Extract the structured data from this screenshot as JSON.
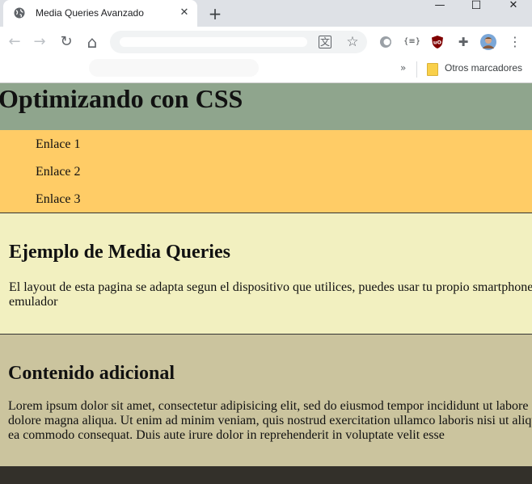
{
  "browser": {
    "tab_title": "Media Queries Avanzado",
    "tab_close_glyph": "✕",
    "new_tab_glyph": "+",
    "window_minimize_glyph": "—",
    "window_maximize_glyph": "☐",
    "window_close_glyph": "✕",
    "back_glyph": "←",
    "forward_glyph": "→",
    "reload_glyph": "↻",
    "home_glyph": "⌂",
    "translate_glyph": "文",
    "star_glyph": "☆",
    "menu_glyph": "⋮",
    "bookmarks_chevron": "»",
    "bookmarks_folder_label": "Otros marcadores",
    "extensions": {
      "ext_json_label": "{≡}",
      "ublock_label": "uO",
      "puzzle_glyph": "✚"
    }
  },
  "page": {
    "title": "Optimizando con CSS",
    "nav_links": [
      "Enlace 1",
      "Enlace 2",
      "Enlace 3"
    ],
    "section1": {
      "heading": "Ejemplo de Media Queries",
      "text": "El layout de esta pagina se adapta segun el dispositivo que utilices, puedes usar tu propio smartphone o un emulador"
    },
    "section2": {
      "heading": "Contenido adicional",
      "text": "Lorem ipsum dolor sit amet, consectetur adipisicing elit, sed do eiusmod tempor incididunt ut labore et dolore magna aliqua. Ut enim ad minim veniam, quis nostrud exercitation ullamco laboris nisi ut aliquip ex ea commodo consequat. Duis aute irure dolor in reprehenderit in voluptate velit esse"
    }
  },
  "colors": {
    "header_bg": "#8fa58d",
    "nav_bg": "#ffcc66",
    "section1_bg": "#f2f0c0",
    "section2_bg": "#cbc49e",
    "footer_bg": "#33302a",
    "tabbar_bg": "#dee1e6"
  }
}
